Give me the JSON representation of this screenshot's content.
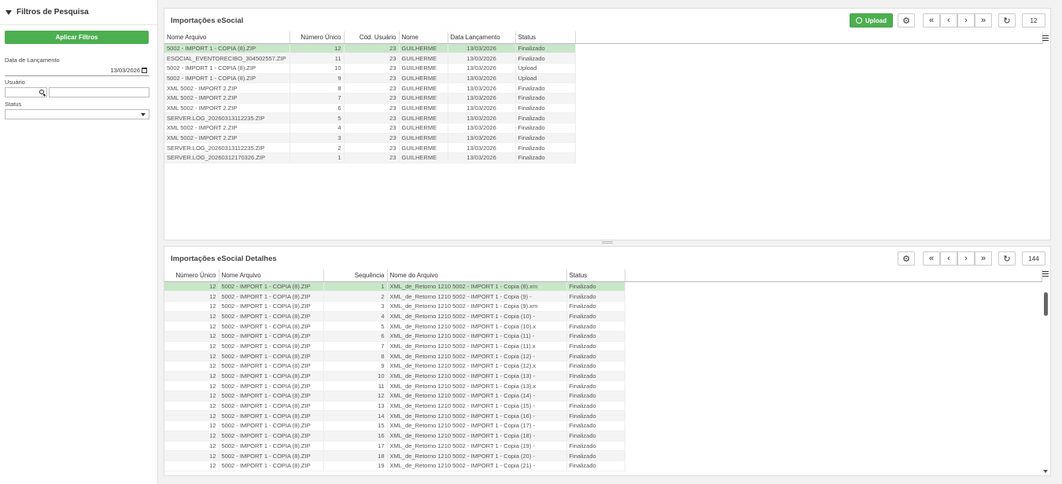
{
  "filters": {
    "title": "Filtros de Pesquisa",
    "apply_label": "Aplicar Filtros",
    "date_label": "Data de Lançamento",
    "date_value": "13/03/2026",
    "user_label": "Usuário",
    "status_label": "Status"
  },
  "top_panel": {
    "title": "Importações eSocial",
    "upload_label": "Upload",
    "count": "12",
    "columns": [
      "Nome Arquivo",
      "Número Único",
      "Cód. Usuário",
      "Nome",
      "Data Lançamento",
      "Status"
    ],
    "rows": [
      [
        "5002 - IMPORT 1 - COPIA (8).ZIP",
        "12",
        "23",
        "GUILHERME",
        "13/03/2026",
        "Finalizado"
      ],
      [
        "ESOCIAL_EVENTORECIBO_304502557.ZIP",
        "11",
        "23",
        "GUILHERME",
        "13/03/2026",
        "Finalizado"
      ],
      [
        "5002 - IMPORT 1 - COPIA (8).ZIP",
        "10",
        "23",
        "GUILHERME",
        "13/03/2026",
        "Upload"
      ],
      [
        "5002 - IMPORT 1 - COPIA (8).ZIP",
        "9",
        "23",
        "GUILHERME",
        "13/03/2026",
        "Upload"
      ],
      [
        "XML 5002 - IMPORT 2.ZIP",
        "8",
        "23",
        "GUILHERME",
        "13/03/2026",
        "Finalizado"
      ],
      [
        "XML 5002 - IMPORT 2.ZIP",
        "7",
        "23",
        "GUILHERME",
        "13/03/2026",
        "Finalizado"
      ],
      [
        "XML 5002 - IMPORT 2.ZIP",
        "6",
        "23",
        "GUILHERME",
        "13/03/2026",
        "Finalizado"
      ],
      [
        "SERVER.LOG_20260313112235.ZIP",
        "5",
        "23",
        "GUILHERME",
        "13/03/2026",
        "Finalizado"
      ],
      [
        "XML 5002 - IMPORT 2.ZIP",
        "4",
        "23",
        "GUILHERME",
        "13/03/2026",
        "Finalizado"
      ],
      [
        "XML 5002 - IMPORT 2.ZIP",
        "3",
        "23",
        "GUILHERME",
        "13/03/2026",
        "Finalizado"
      ],
      [
        "SERVER.LOG_20260313112235.ZIP",
        "2",
        "23",
        "GUILHERME",
        "13/03/2026",
        "Finalizado"
      ],
      [
        "SERVER.LOG_20260312170326.ZIP",
        "1",
        "23",
        "GUILHERME",
        "13/03/2026",
        "Finalizado"
      ]
    ]
  },
  "bottom_panel": {
    "title": "Importações eSocial Detalhes",
    "count": "144",
    "columns": [
      "Número Único",
      "Nome Arquivo",
      "Sequência",
      "Nome do Arquivo",
      "Status"
    ],
    "rows": [
      [
        "12",
        "5002 - IMPORT 1 - COPIA (8).ZIP",
        "1",
        "XML_de_Retorno 1210 5002 - IMPORT 1 - Copia (8).xm",
        "Finalizado"
      ],
      [
        "12",
        "5002 - IMPORT 1 - COPIA (8).ZIP",
        "2",
        "XML_de_Retorno 1210 5002 - IMPORT 1 - Copia (9) -",
        "Finalizado"
      ],
      [
        "12",
        "5002 - IMPORT 1 - COPIA (8).ZIP",
        "3",
        "XML_de_Retorno 1210 5002 - IMPORT 1 - Copia (9).xm",
        "Finalizado"
      ],
      [
        "12",
        "5002 - IMPORT 1 - COPIA (8).ZIP",
        "4",
        "XML_de_Retorno 1210 5002 - IMPORT 1 - Copia (10) -",
        "Finalizado"
      ],
      [
        "12",
        "5002 - IMPORT 1 - COPIA (8).ZIP",
        "5",
        "XML_de_Retorno 1210 5002 - IMPORT 1 - Copia (10).x",
        "Finalizado"
      ],
      [
        "12",
        "5002 - IMPORT 1 - COPIA (8).ZIP",
        "6",
        "XML_de_Retorno 1210 5002 - IMPORT 1 - Copia (11) -",
        "Finalizado"
      ],
      [
        "12",
        "5002 - IMPORT 1 - COPIA (8).ZIP",
        "7",
        "XML_de_Retorno 1210 5002 - IMPORT 1 - Copia (11).x",
        "Finalizado"
      ],
      [
        "12",
        "5002 - IMPORT 1 - COPIA (8).ZIP",
        "8",
        "XML_de_Retorno 1210 5002 - IMPORT 1 - Copia (12) -",
        "Finalizado"
      ],
      [
        "12",
        "5002 - IMPORT 1 - COPIA (8).ZIP",
        "9",
        "XML_de_Retorno 1210 5002 - IMPORT 1 - Copia (12).x",
        "Finalizado"
      ],
      [
        "12",
        "5002 - IMPORT 1 - COPIA (8).ZIP",
        "10",
        "XML_de_Retorno 1210 5002 - IMPORT 1 - Copia (13) -",
        "Finalizado"
      ],
      [
        "12",
        "5002 - IMPORT 1 - COPIA (8).ZIP",
        "11",
        "XML_de_Retorno 1210 5002 - IMPORT 1 - Copia (13).x",
        "Finalizado"
      ],
      [
        "12",
        "5002 - IMPORT 1 - COPIA (8).ZIP",
        "12",
        "XML_de_Retorno 1210 5002 - IMPORT 1 - Copia (14) -",
        "Finalizado"
      ],
      [
        "12",
        "5002 - IMPORT 1 - COPIA (8).ZIP",
        "13",
        "XML_de_Retorno 1210 5002 - IMPORT 1 - Copia (15) -",
        "Finalizado"
      ],
      [
        "12",
        "5002 - IMPORT 1 - COPIA (8).ZIP",
        "14",
        "XML_de_Retorno 1210 5002 - IMPORT 1 - Copia (16) -",
        "Finalizado"
      ],
      [
        "12",
        "5002 - IMPORT 1 - COPIA (8).ZIP",
        "15",
        "XML_de_Retorno 1210 5002 - IMPORT 1 - Copia (17) -",
        "Finalizado"
      ],
      [
        "12",
        "5002 - IMPORT 1 - COPIA (8).ZIP",
        "16",
        "XML_de_Retorno 1210 5002 - IMPORT 1 - Copia (18) -",
        "Finalizado"
      ],
      [
        "12",
        "5002 - IMPORT 1 - COPIA (8).ZIP",
        "17",
        "XML_de_Retorno 1210 5002 - IMPORT 1 - Copia (19) -",
        "Finalizado"
      ],
      [
        "12",
        "5002 - IMPORT 1 - COPIA (8).ZIP",
        "18",
        "XML_de_Retorno 1210 5002 - IMPORT 1 - Copia (20) -",
        "Finalizado"
      ],
      [
        "12",
        "5002 - IMPORT 1 - COPIA (8).ZIP",
        "19",
        "XML_de_Retorno 1210 5002 - IMPORT 1 - Copia (21) -",
        "Finalizado"
      ]
    ]
  },
  "colors": {
    "accent_green": "#4caf50",
    "selected_row": "#c9e6c9"
  },
  "icons": [
    "funnel-icon",
    "calendar-icon",
    "search-icon",
    "caret-down-icon",
    "upload-icon",
    "gear-icon",
    "first-page-icon",
    "prev-page-icon",
    "next-page-icon",
    "last-page-icon",
    "refresh-icon",
    "menu-icon"
  ]
}
